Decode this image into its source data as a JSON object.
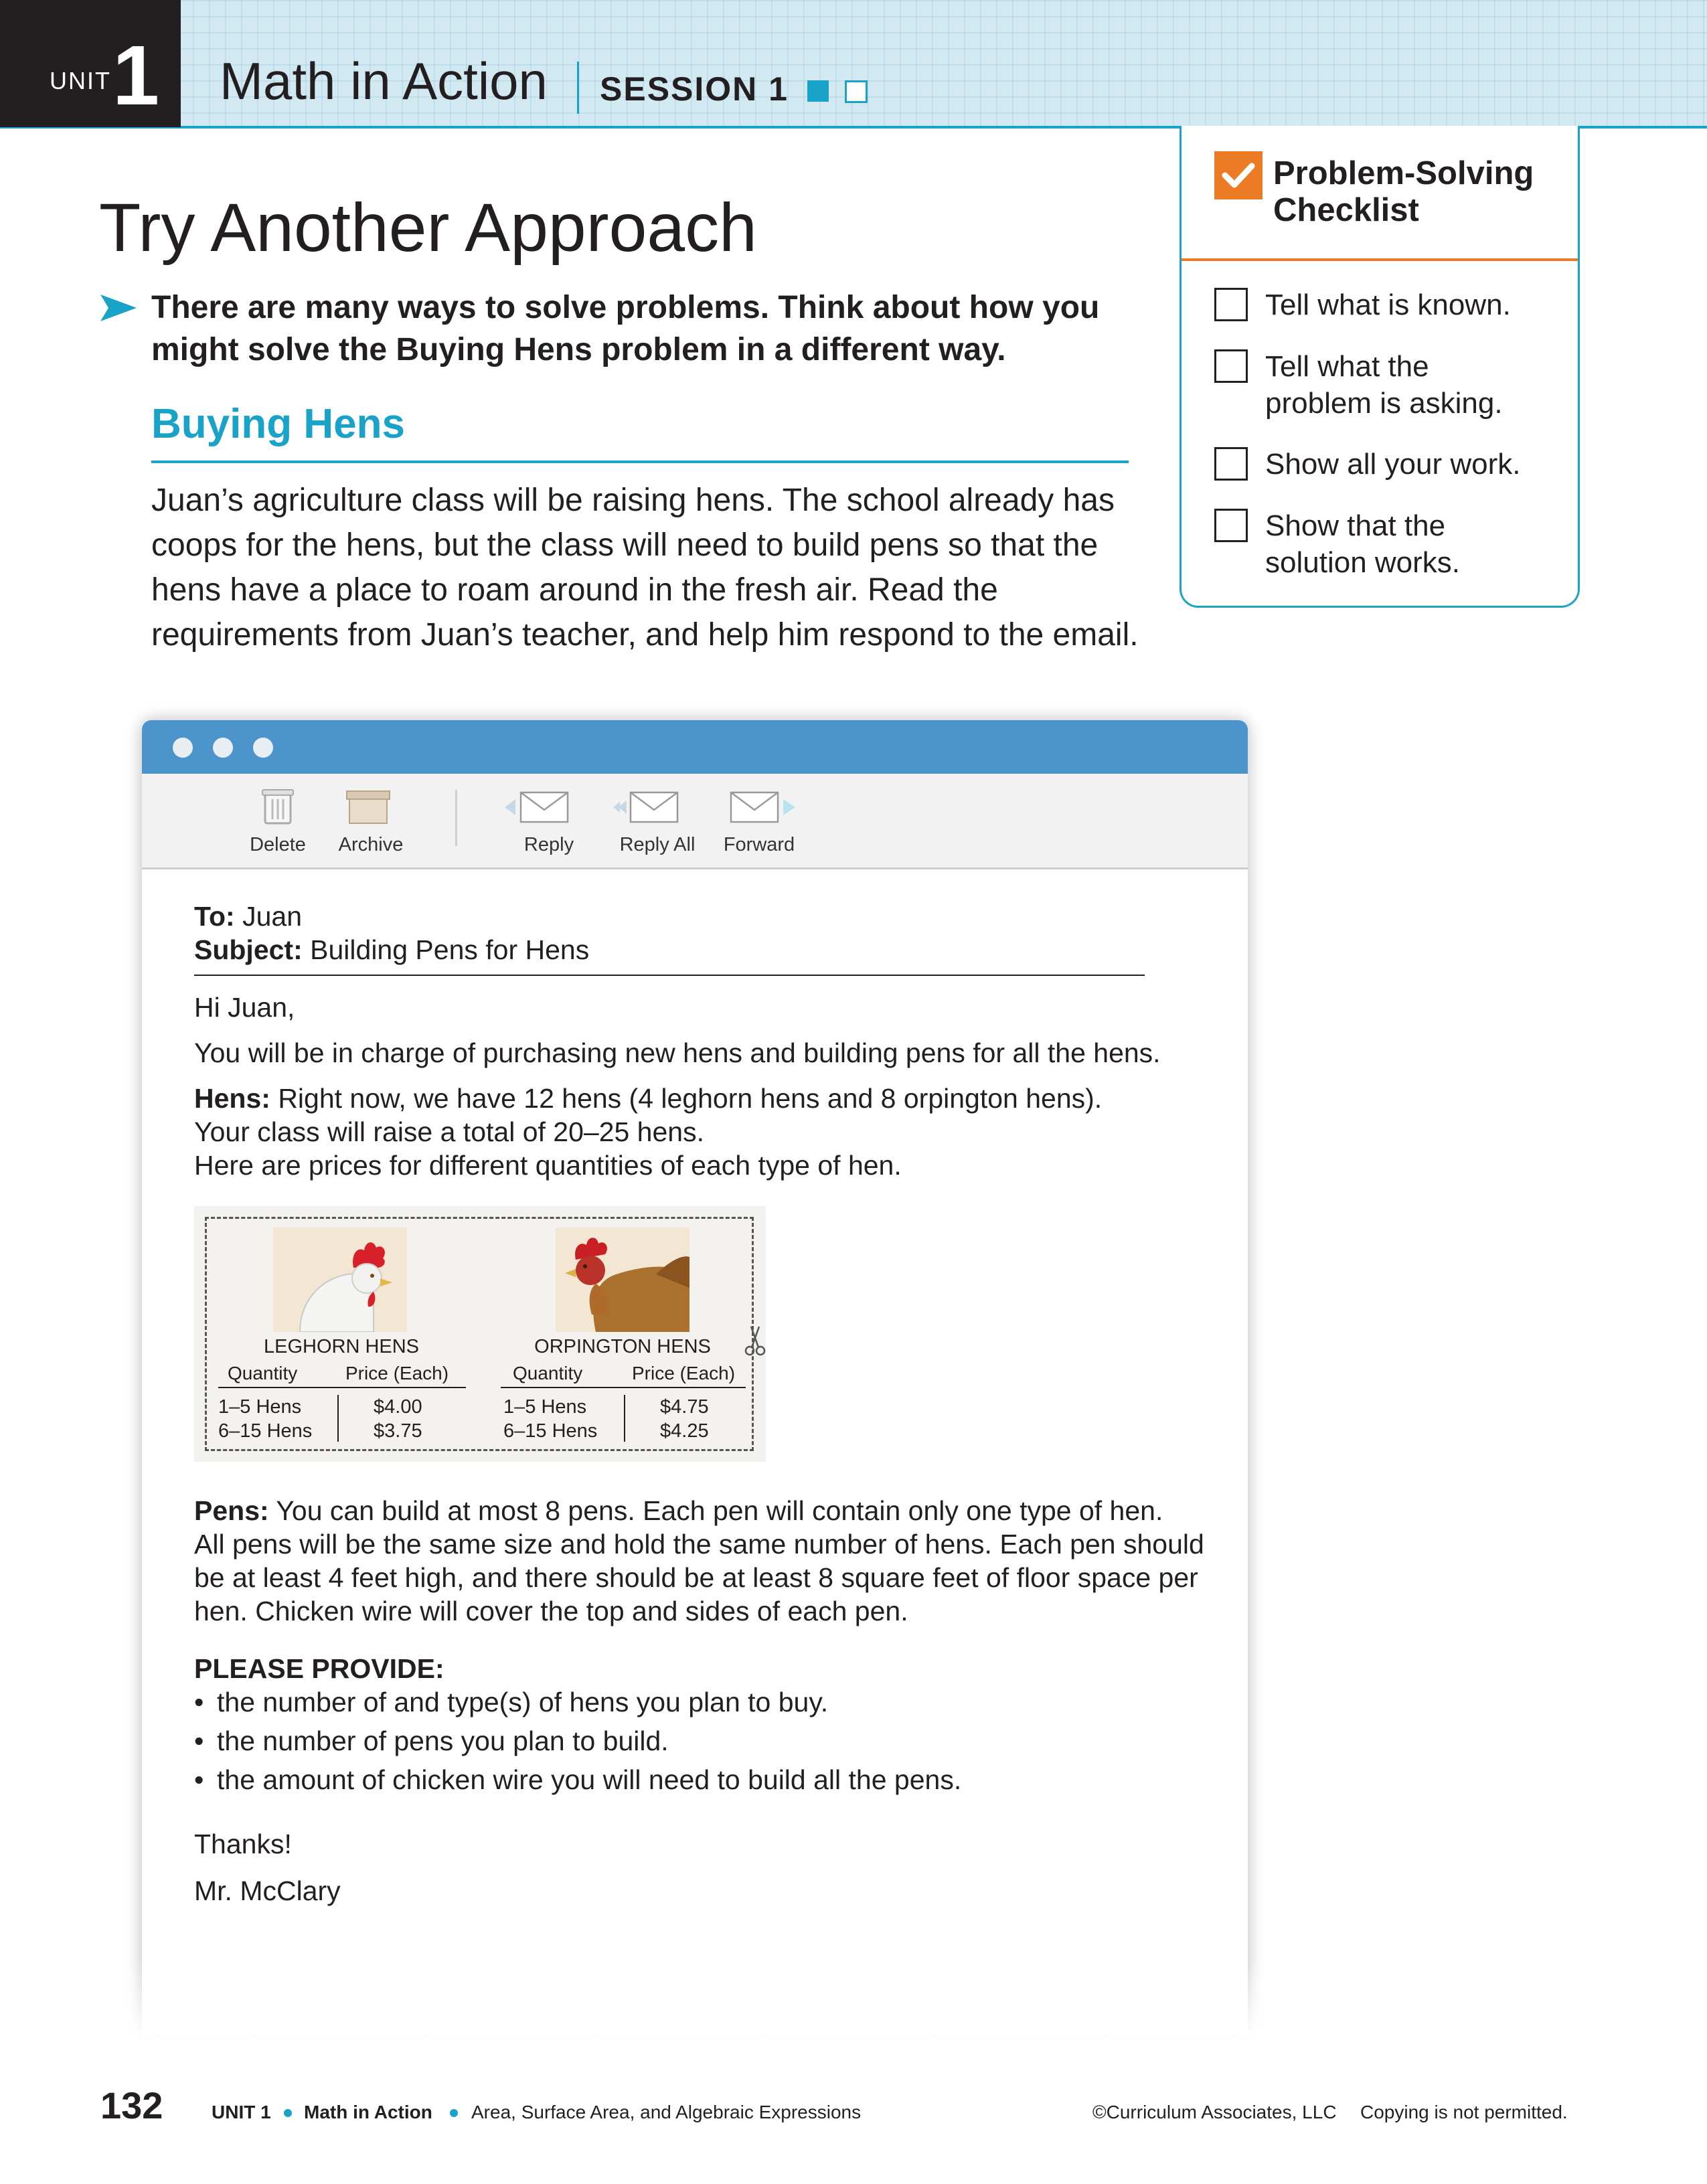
{
  "header": {
    "unit_word": "UNIT",
    "unit_number": "1",
    "title": "Math in Action",
    "session": "SESSION 1",
    "accent_color": "#19a3c9"
  },
  "page": {
    "title": "Try Another Approach",
    "intro": "There are many ways to solve problems. Think about how you might solve the Buying Hens problem in a different way.",
    "section_heading": "Buying Hens",
    "story": "Juan’s agriculture class will be raising hens. The school already has coops for the hens, but the class will need to build pens so that the hens have a place to roam around in the fresh air. Read the requirements from Juan’s teacher, and help him respond to the email."
  },
  "checklist": {
    "title_line1": "Problem-Solving",
    "title_line2": "Checklist",
    "items": [
      {
        "line1": "Tell what is known.",
        "line2": ""
      },
      {
        "line1": "Tell what the",
        "line2": "problem is asking."
      },
      {
        "line1": "Show all your work.",
        "line2": ""
      },
      {
        "line1": "Show that the",
        "line2": "solution works."
      }
    ],
    "badge_color": "#ec7b26"
  },
  "email": {
    "toolbar": {
      "delete": "Delete",
      "archive": "Archive",
      "reply": "Reply",
      "reply_all": "Reply All",
      "forward": "Forward"
    },
    "to_label": "To:",
    "to_value": "Juan",
    "subject_label": "Subject:",
    "subject_value": "Building Pens for Hens",
    "greeting": "Hi Juan,",
    "line1": "You will be in charge of purchasing new hens and building pens for all the hens.",
    "hens_label": "Hens:",
    "hens_line1": "Right now, we have 12 hens (4 leghorn hens and 8 orpington hens).",
    "hens_line2": "Your class will raise a total of 20–25 hens.",
    "hens_line3": "Here are prices for different quantities of each type of hen.",
    "pens_label": "Pens:",
    "pens_line1": "You can build at most 8 pens. Each pen will contain only one type of hen.",
    "pens_line2": "All pens will be the same size and hold the same number of hens. Each pen should",
    "pens_line3": "be at least 4 feet high, and there should be at least 8 square feet of floor space per",
    "pens_line4": "hen. Chicken wire will cover the top and sides of each pen.",
    "provide_heading": "PLEASE PROVIDE:",
    "provide_items": [
      "the number of and type(s) of hens you plan to buy.",
      "the number of pens you plan to build.",
      "the amount of chicken wire you will need to build all the pens."
    ],
    "thanks": "Thanks!",
    "signature": "Mr. McClary"
  },
  "hen_prices": {
    "quantity_header": "Quantity",
    "price_header": "Price (Each)",
    "leghorn": {
      "title": "LEGHORN HENS",
      "rows": [
        {
          "qty": "1–5 Hens",
          "price": "$4.00"
        },
        {
          "qty": "6–15 Hens",
          "price": "$3.75"
        }
      ]
    },
    "orpington": {
      "title": "ORPINGTON HENS",
      "rows": [
        {
          "qty": "1–5 Hens",
          "price": "$4.75"
        },
        {
          "qty": "6–15 Hens",
          "price": "$4.25"
        }
      ]
    }
  },
  "footer": {
    "page_number": "132",
    "unit": "UNIT 1",
    "section": "Math in Action",
    "topic": "Area, Surface Area, and Algebraic Expressions",
    "copyright": "©Curriculum Associates, LLC",
    "notice": "Copying is not permitted."
  }
}
